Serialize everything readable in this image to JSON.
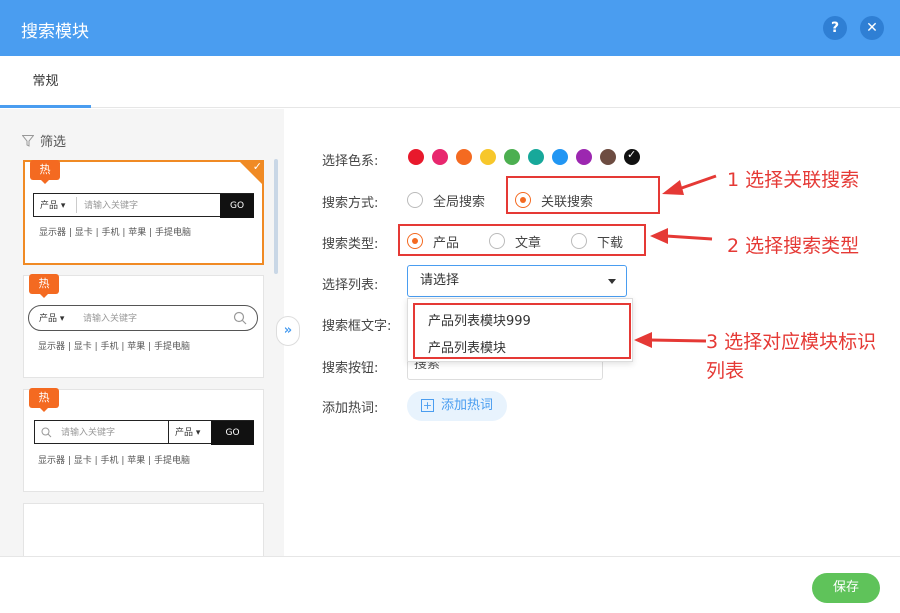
{
  "dialog": {
    "title": "搜索模块"
  },
  "tabs": [
    {
      "label": "常规"
    }
  ],
  "left": {
    "filter_label": "筛选",
    "templates": [
      {
        "badge": "热",
        "category": "产品 ▾",
        "placeholder": "请输入关键字",
        "button": "GO",
        "hotwords": "显示器 | 显卡 | 手机 | 苹果 | 手提电脑",
        "selected": true
      },
      {
        "badge": "热",
        "category": "产品 ▾",
        "placeholder": "请输入关键字",
        "hotwords": "显示器 | 显卡 | 手机 | 苹果 | 手提电脑"
      },
      {
        "badge": "热",
        "category": "产品 ▾",
        "placeholder": "请输入关键字",
        "button": "GO",
        "hotwords": "显示器 | 显卡 | 手机 | 苹果 | 手提电脑"
      }
    ]
  },
  "form": {
    "color_label": "选择色系:",
    "colors": [
      "#e8192c",
      "#e8276e",
      "#f46a21",
      "#f7c72b",
      "#4caf50",
      "#17a89a",
      "#2196f3",
      "#9c27b0",
      "#6d4c41",
      "#111111"
    ],
    "search_mode_label": "搜索方式:",
    "search_mode_options": [
      "全局搜索",
      "关联搜索"
    ],
    "search_mode_selected": "关联搜索",
    "search_type_label": "搜索类型:",
    "search_type_options": [
      "产品",
      "文章",
      "下载"
    ],
    "search_type_selected": "产品",
    "list_label": "选择列表:",
    "list_placeholder": "请选择",
    "list_options": [
      "产品列表模块999",
      "产品列表模块"
    ],
    "box_text_label": "搜索框文字:",
    "button_label": "搜索按钮:",
    "button_value": "搜索",
    "hotword_label": "添加热词:",
    "add_hotword": "添加热词"
  },
  "footer": {
    "save": "保存"
  },
  "annotations": {
    "step1": "1 选择关联搜索",
    "step2": "2 选择搜索类型",
    "step3_line1": "3 选择对应模块标识",
    "step3_line2": "列表"
  }
}
